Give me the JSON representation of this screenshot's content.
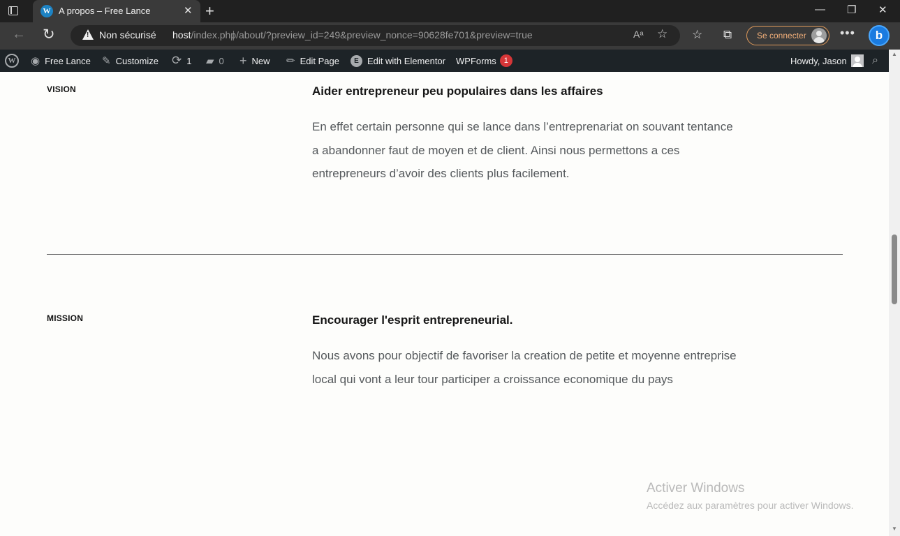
{
  "browser": {
    "tab_title": "A propos – Free Lance",
    "tab_favicon": "wordpress-icon",
    "new_tab_glyph": "+",
    "window_controls": [
      "minimize-icon",
      "restore-icon",
      "close-icon"
    ],
    "security_label": "Non sécurisé",
    "url_host": "host",
    "url_rest": "/index.php/about/?preview_id=249&preview_nonce=90628fe701&preview=true",
    "sign_in_label": "Se connecter",
    "bing_letter": "b"
  },
  "admin_bar": {
    "site_name": "Free Lance",
    "customize": "Customize",
    "updates_count": "1",
    "comments_count": "0",
    "new_label": "New",
    "edit_page": "Edit Page",
    "edit_elementor": "Edit with Elementor",
    "wpforms": "WPForms",
    "wpforms_badge": "1",
    "howdy": "Howdy, Jason"
  },
  "sections": [
    {
      "label": "VISION",
      "heading": "Aider entrepreneur peu populaires dans les affaires",
      "lines": [
        "En effet certain personne qui se lance dans l’entreprenariat on souvant tentance",
        "a abandonner faut de moyen et de client. Ainsi nous permettons a ces",
        "entrepreneurs d’avoir des clients plus facilement."
      ]
    },
    {
      "label": "MISSION",
      "heading": "Encourager l'esprit entrepreneurial.",
      "lines": [
        "Nous avons pour objectif de favoriser la creation de petite et moyenne entreprise",
        "local qui vont a leur tour participer a croissance economique du pays"
      ]
    }
  ],
  "watermark": {
    "title": "Activer Windows",
    "subtitle": "Accédez aux paramètres pour activer Windows."
  }
}
